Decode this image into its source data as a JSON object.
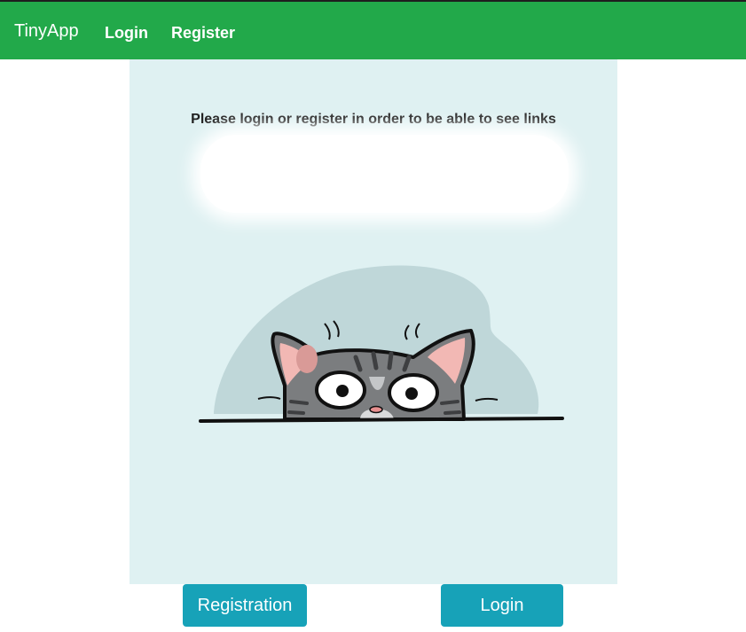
{
  "navbar": {
    "brand": "TinyApp",
    "links": [
      {
        "label": "Login"
      },
      {
        "label": "Register"
      }
    ],
    "color": "#22a94a"
  },
  "main": {
    "message": "Please login or register in order to be able to see links",
    "illustration": "cat-peeking-icon"
  },
  "buttons": {
    "registration_label": "Registration",
    "login_label": "Login",
    "color": "#17a2b8"
  }
}
